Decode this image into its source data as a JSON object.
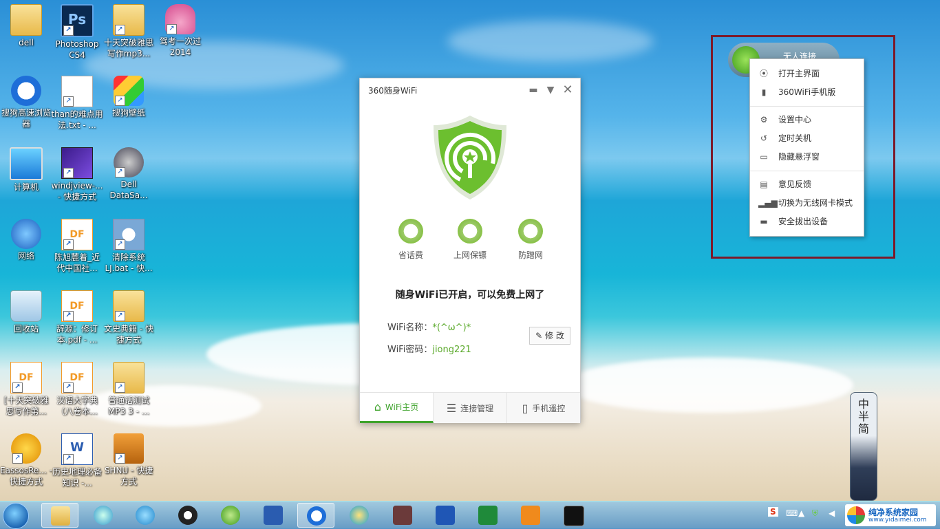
{
  "desktop": {
    "icons": [
      {
        "label": "dell",
        "icon": "user-folder-icon"
      },
      {
        "label": "Photoshop CS4",
        "icon": "photoshop-icon"
      },
      {
        "label": "十天突破雅思写作mp3...",
        "icon": "folder-icon"
      },
      {
        "label": "驾考一次过 2014",
        "icon": "car-app-icon"
      },
      {
        "label": "搜狗高速浏览器",
        "icon": "sogou-browser-icon"
      },
      {
        "label": "than的难点用法.txt - ...",
        "icon": "text-file-icon"
      },
      {
        "label": "搜狗壁纸",
        "icon": "sogou-wallpaper-icon"
      },
      {
        "label": "计算机",
        "icon": "computer-icon"
      },
      {
        "label": "windjview-... - 快捷方式",
        "icon": "windjview-icon"
      },
      {
        "label": "Dell DataSa...",
        "icon": "dell-datasafe-icon"
      },
      {
        "label": "网络",
        "icon": "network-icon"
      },
      {
        "label": "陈旭麓着_近代中国社...",
        "icon": "pdf-file-icon"
      },
      {
        "label": "清除系统LJ.bat - 快...",
        "icon": "batch-file-icon"
      },
      {
        "label": "回收站",
        "icon": "recycle-bin-icon"
      },
      {
        "label": "辞源：修订本.pdf - ...",
        "icon": "pdf-file-icon"
      },
      {
        "label": "文史典籍 - 快捷方式",
        "icon": "folder-icon"
      },
      {
        "label": "[十天突破雅思写作第...",
        "icon": "pdf-file-icon"
      },
      {
        "label": "汉语大字典（八卷本...",
        "icon": "pdf-file-icon"
      },
      {
        "label": "普通话测试MP3 3 - ...",
        "icon": "folder-icon"
      },
      {
        "label": "EassosRe... - 快捷方式",
        "icon": "eassos-icon"
      },
      {
        "label": "历史地理必备知识 -...",
        "icon": "word-doc-icon"
      },
      {
        "label": "SHNU - 快捷方式",
        "icon": "briefcase-icon"
      }
    ]
  },
  "wifi_window": {
    "title": "360随身WiFi",
    "features": [
      {
        "label": "省话费",
        "icon": "yen-coin-icon"
      },
      {
        "label": "上网保镖",
        "icon": "shield-guard-icon"
      },
      {
        "label": "防蹭网",
        "icon": "anti-leech-icon"
      }
    ],
    "status": "随身WiFi已开启，可以免费上网了",
    "name_label": "WiFi名称：",
    "name_value": "*(^ω^)*",
    "password_label": "WiFi密码：",
    "password_value": "jiong221",
    "edit_label": "修 改",
    "tabs": [
      {
        "label": "WiFi主页",
        "icon": "home-icon",
        "active": true
      },
      {
        "label": "连接管理",
        "icon": "list-icon",
        "active": false
      },
      {
        "label": "手机遥控",
        "icon": "phone-icon",
        "active": false
      }
    ]
  },
  "float_widget": {
    "label": "无人连接"
  },
  "context_menu": {
    "items": [
      {
        "label": "打开主界面",
        "icon": "antenna-icon"
      },
      {
        "label": "360WiFi手机版",
        "icon": "mobile-icon"
      },
      {
        "label": "设置中心",
        "icon": "gear-icon"
      },
      {
        "label": "定时关机",
        "icon": "timer-icon"
      },
      {
        "label": "隐藏悬浮窗",
        "icon": "hide-window-icon"
      },
      {
        "label": "意见反馈",
        "icon": "feedback-icon"
      },
      {
        "label": "切换为无线网卡模式",
        "icon": "signal-bars-icon"
      },
      {
        "label": "安全拔出设备",
        "icon": "usb-eject-icon"
      }
    ]
  },
  "ime": {
    "chars": [
      "中",
      "半",
      "简"
    ]
  },
  "watermark": {
    "title": "纯净系统家园",
    "url": "www.yidaimei.com"
  },
  "taskbar": {
    "apps": [
      "file-explorer-icon",
      "itunes-icon",
      "qq-bubble-icon",
      "qq-penguin-icon",
      "360-wifi-icon",
      "word-icon",
      "sogou-icon",
      "browser-icon",
      "reader-icon",
      "word-icon",
      "excel-icon",
      "pdf-icon",
      "cmd-icon"
    ],
    "tray_ime": "S"
  }
}
